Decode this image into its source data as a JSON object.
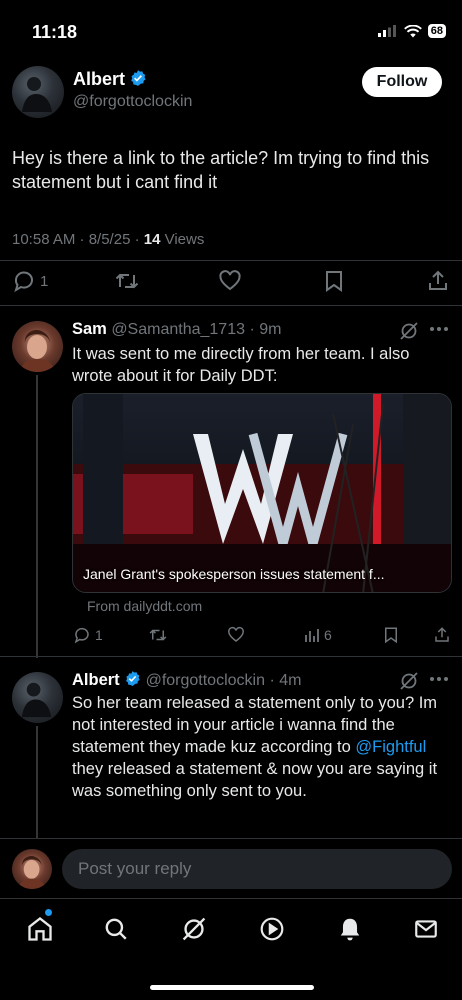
{
  "status_bar": {
    "time": "11:18",
    "battery": "68"
  },
  "main_tweet": {
    "author_name": "Albert",
    "handle": "@forgottoclockin",
    "follow_label": "Follow",
    "text": "Hey is there a link to the article? Im trying to find this statement but i cant find it",
    "timestamp": "10:58 AM · 8/5/25 · ",
    "views_count": "14",
    "views_label": " Views",
    "reply_count": "1"
  },
  "replies": [
    {
      "author_name": "Sam",
      "handle": "@Samantha_1713",
      "time": "· 9m",
      "text": "It was sent to me directly from her team. I also wrote about it for Daily DDT:",
      "card_title": "Janel Grant's spokesperson issues statement f...",
      "card_source": "From dailyddt.com",
      "reply_count": "1",
      "views_count": "6"
    },
    {
      "author_name": "Albert",
      "handle": "@forgottoclockin",
      "time": "· 4m",
      "text_before": "So her team released a statement only to you? Im not interested in your article i wanna find the statement they made kuz according to ",
      "mention": "@Fightful",
      "text_after": " they released a statement & now you are saying it was something only sent to you."
    }
  ],
  "composer": {
    "placeholder": "Post your reply"
  },
  "colors": {
    "accent": "#1d9bf0",
    "background": "#000000",
    "muted": "#71767b"
  }
}
